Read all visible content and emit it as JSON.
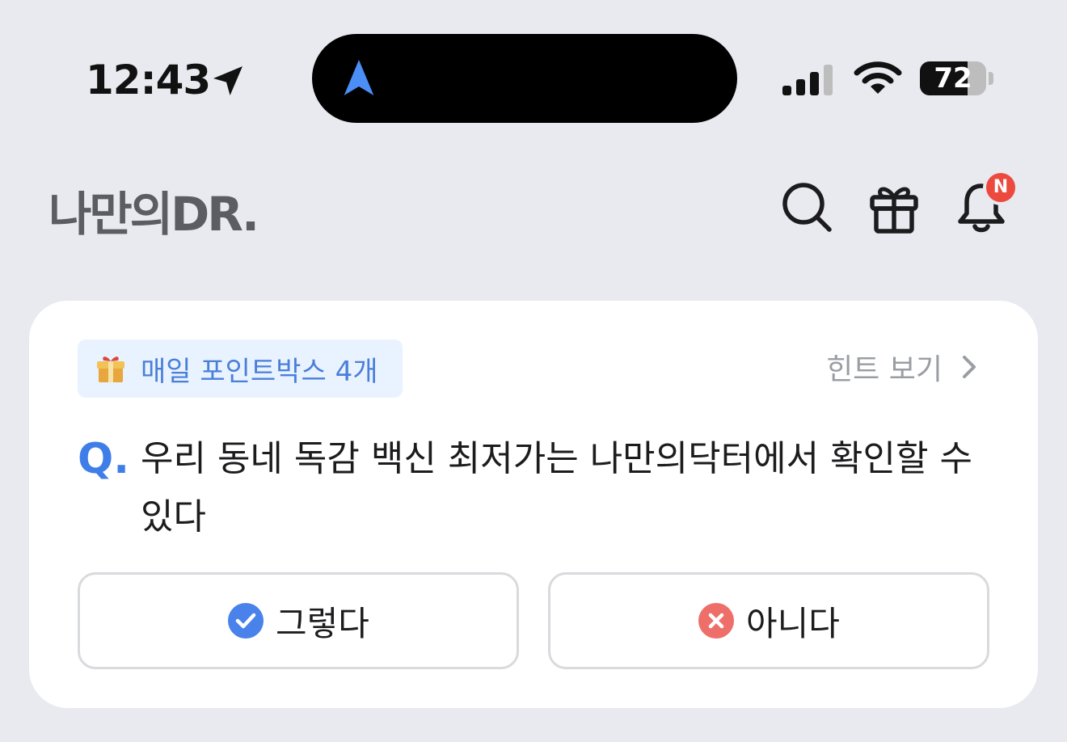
{
  "status_bar": {
    "time": "12:43",
    "battery_level": "72",
    "battery_fraction": 0.72,
    "icons": [
      "location-arrow-icon",
      "navigation-icon",
      "cellular-signal-icon",
      "wifi-icon",
      "battery-icon"
    ]
  },
  "header": {
    "logo": "나만의DR.",
    "notification_badge": "N",
    "icons": [
      "search-icon",
      "gift-icon",
      "bell-icon"
    ]
  },
  "quiz_card": {
    "points_chip_label": "매일 포인트박스 4개",
    "hint_label": "힌트 보기",
    "question_marker": "Q.",
    "question": "우리 동네 독감 백신 최저가는 나만의닥터에서 확인할 수 있다",
    "yes_label": "그렇다",
    "no_label": "아니다"
  },
  "colors": {
    "accent_blue": "#3f7ee8",
    "badge_red": "#ec4a3f",
    "no_red": "#ee6f6a",
    "background": "#e9eaf0"
  }
}
